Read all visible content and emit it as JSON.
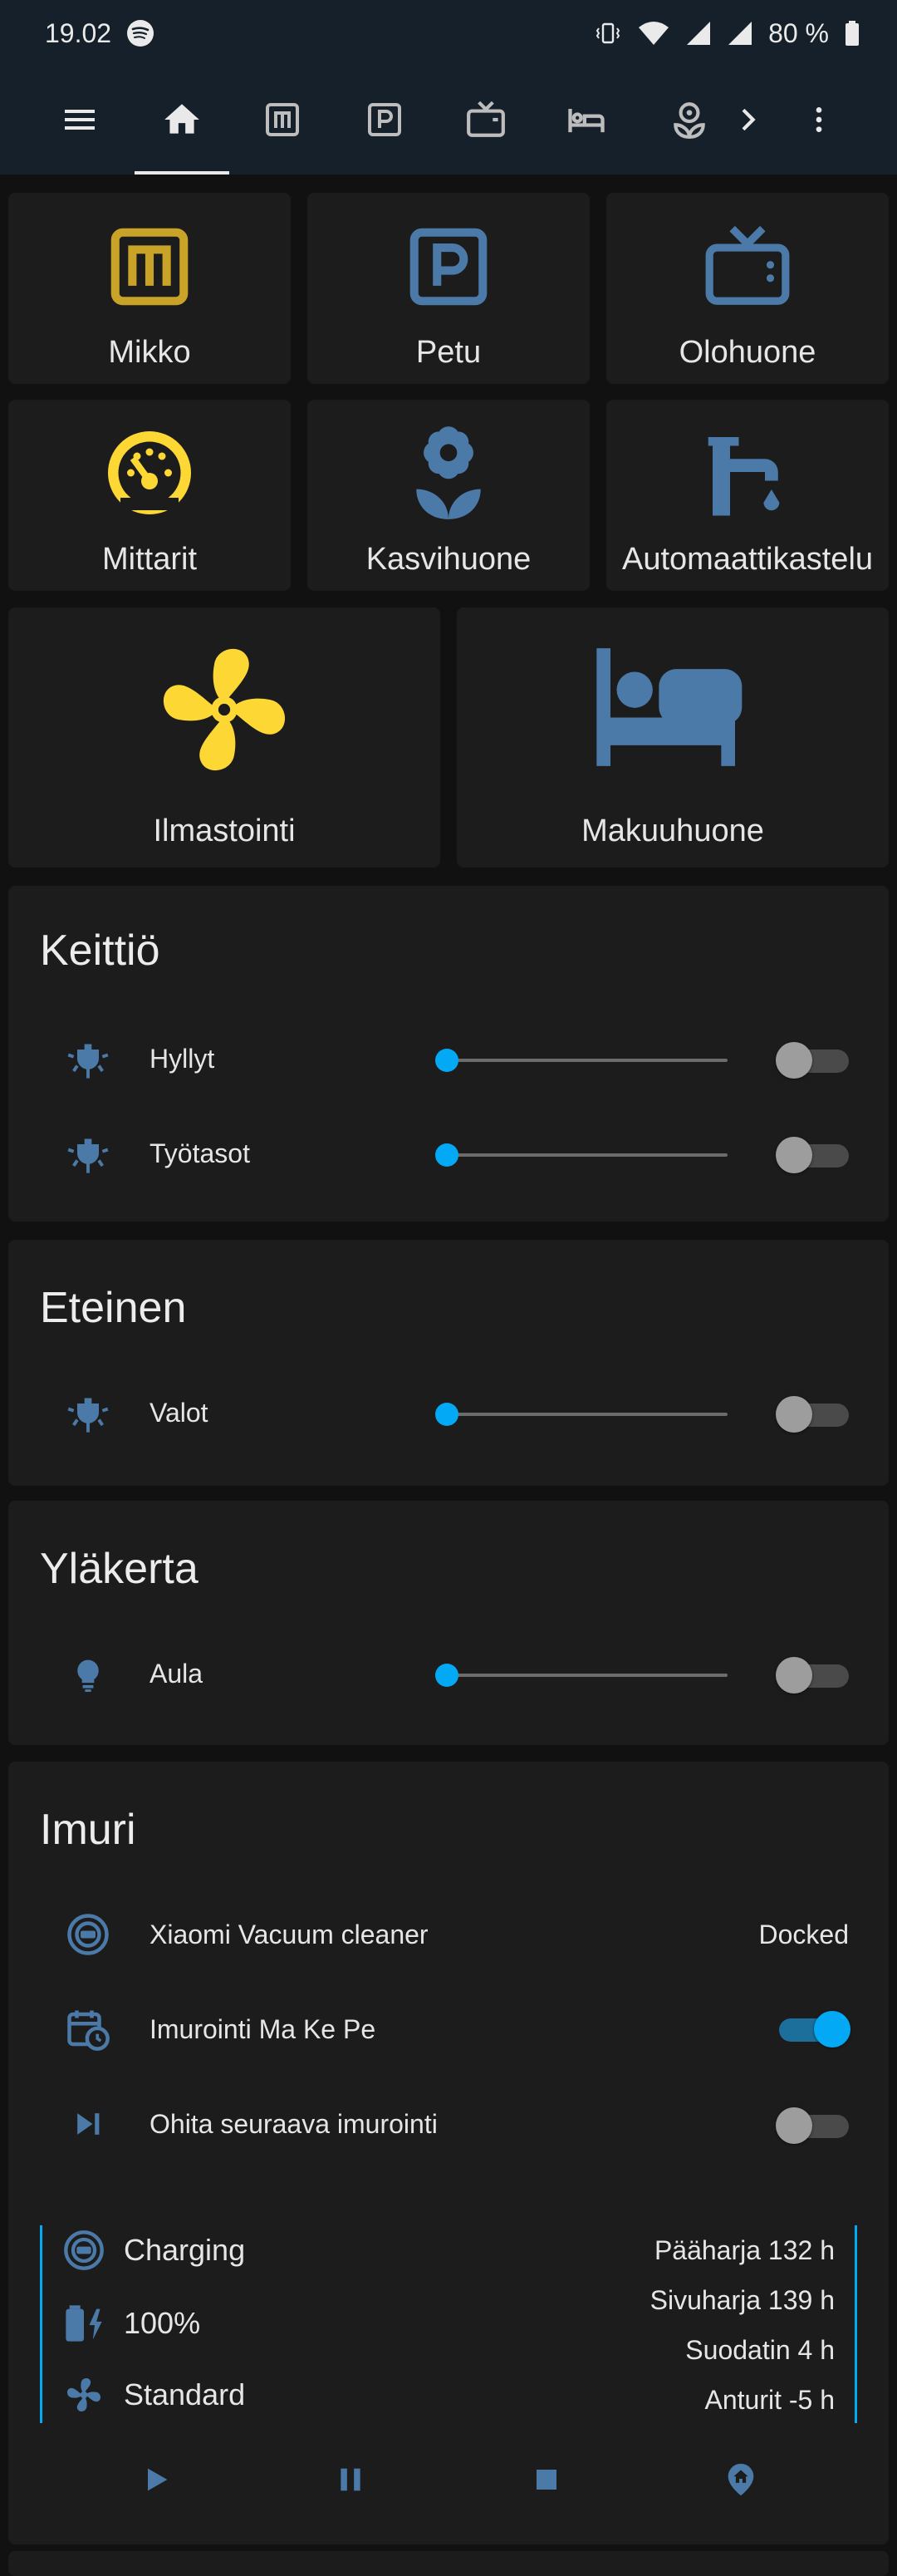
{
  "status_bar": {
    "time": "19.02",
    "battery": "80 %"
  },
  "colors": {
    "blue": "#4b7aa8",
    "yellow": "#fdd835",
    "accent": "#03a9f4",
    "gold": "#c9a228"
  },
  "tiles": [
    {
      "label": "Mikko",
      "icon": "alpha-m-box-icon"
    },
    {
      "label": "Petu",
      "icon": "alpha-p-box-icon"
    },
    {
      "label": "Olohuone",
      "icon": "television-icon"
    },
    {
      "label": "Mittarit",
      "icon": "gauge-icon"
    },
    {
      "label": "Kasvihuone",
      "icon": "flower-icon"
    },
    {
      "label": "Automaattikastelu",
      "icon": "water-tap-icon"
    },
    {
      "label": "Ilmastointi",
      "icon": "fan-icon"
    },
    {
      "label": "Makuuhuone",
      "icon": "bed-icon"
    }
  ],
  "kitchen": {
    "title": "Keittiö",
    "rows": [
      {
        "label": "Hyllyt",
        "brightness": 0,
        "on": false
      },
      {
        "label": "Työtasot",
        "brightness": 0,
        "on": false
      }
    ]
  },
  "hallway": {
    "title": "Eteinen",
    "rows": [
      {
        "label": "Valot",
        "brightness": 0,
        "on": false
      }
    ]
  },
  "upstairs": {
    "title": "Yläkerta",
    "rows": [
      {
        "label": "Aula",
        "brightness": 0,
        "on": false
      }
    ]
  },
  "vacuum": {
    "title": "Imuri",
    "rows": [
      {
        "label": "Xiaomi Vacuum cleaner",
        "value": "Docked"
      },
      {
        "label": "Imurointi Ma Ke Pe",
        "on": true
      },
      {
        "label": "Ohita seuraava imurointi",
        "on": false
      }
    ],
    "status": {
      "state": "Charging",
      "battery": "100%",
      "fan_speed": "Standard"
    },
    "consumables": [
      "Pääharja 132 h",
      "Sivuharja 139 h",
      "Suodatin 4 h",
      "Anturit -5 h"
    ]
  }
}
